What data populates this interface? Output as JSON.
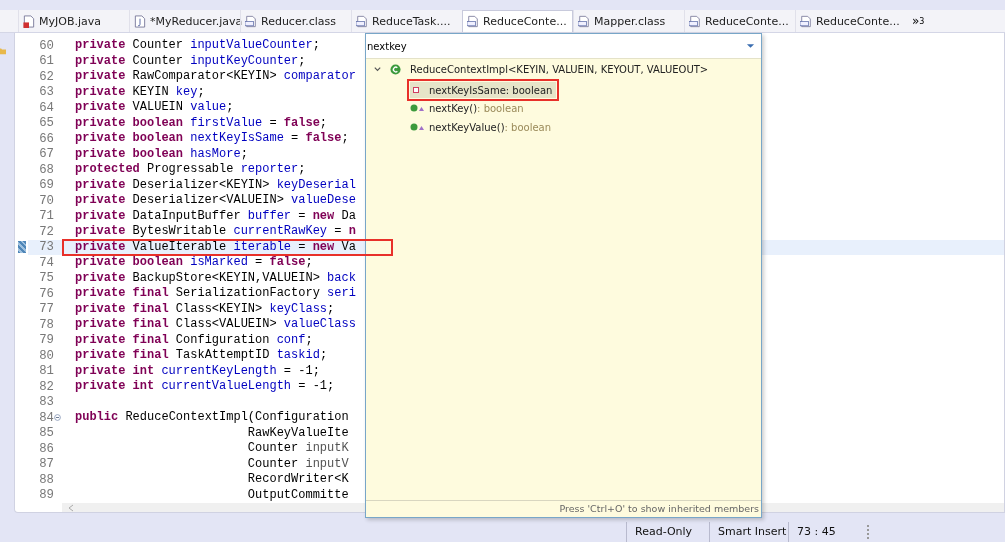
{
  "tabs": [
    {
      "label": "MyJOB.java",
      "kind": "java-error",
      "selected": false
    },
    {
      "label": "*MyReducer.java",
      "kind": "java",
      "selected": false
    },
    {
      "label": "Reducer.class",
      "kind": "class",
      "selected": false
    },
    {
      "label": "ReduceTask....",
      "kind": "class",
      "selected": false
    },
    {
      "label": "ReduceConte...",
      "kind": "class",
      "selected": true
    },
    {
      "label": "Mapper.class",
      "kind": "class",
      "selected": false
    },
    {
      "label": "ReduceConte...",
      "kind": "class",
      "selected": false
    },
    {
      "label": "ReduceConte...",
      "kind": "class",
      "selected": false
    }
  ],
  "tab_overflow": {
    "symbol": "»",
    "count": "3"
  },
  "code_lines": [
    {
      "number": "60",
      "current": false,
      "fold": false,
      "tokens": [
        {
          "kind": "keyword",
          "text": "private "
        },
        {
          "kind": "plain",
          "text": "Counter "
        },
        {
          "kind": "field",
          "text": "inputValueCounter"
        },
        {
          "kind": "plain",
          "text": ";"
        }
      ]
    },
    {
      "number": "61",
      "current": false,
      "fold": false,
      "tokens": [
        {
          "kind": "keyword",
          "text": "private "
        },
        {
          "kind": "plain",
          "text": "Counter "
        },
        {
          "kind": "field",
          "text": "inputKeyCounter"
        },
        {
          "kind": "plain",
          "text": ";"
        }
      ]
    },
    {
      "number": "62",
      "current": false,
      "fold": false,
      "tokens": [
        {
          "kind": "keyword",
          "text": "private "
        },
        {
          "kind": "plain",
          "text": "RawComparator<KEYIN> "
        },
        {
          "kind": "field",
          "text": "comparator"
        }
      ]
    },
    {
      "number": "63",
      "current": false,
      "fold": false,
      "tokens": [
        {
          "kind": "keyword",
          "text": "private "
        },
        {
          "kind": "plain",
          "text": "KEYIN "
        },
        {
          "kind": "field",
          "text": "key"
        },
        {
          "kind": "plain",
          "text": ";"
        }
      ]
    },
    {
      "number": "64",
      "current": false,
      "fold": false,
      "tokens": [
        {
          "kind": "keyword",
          "text": "private "
        },
        {
          "kind": "plain",
          "text": "VALUEIN "
        },
        {
          "kind": "field",
          "text": "value"
        },
        {
          "kind": "plain",
          "text": ";"
        }
      ]
    },
    {
      "number": "65",
      "current": false,
      "fold": false,
      "tokens": [
        {
          "kind": "keyword",
          "text": "private boolean "
        },
        {
          "kind": "field",
          "text": "firstValue"
        },
        {
          "kind": "plain",
          "text": " = "
        },
        {
          "kind": "keyword",
          "text": "false"
        },
        {
          "kind": "plain",
          "text": ";"
        }
      ]
    },
    {
      "number": "66",
      "current": false,
      "fold": false,
      "tokens": [
        {
          "kind": "keyword",
          "text": "private boolean "
        },
        {
          "kind": "field",
          "text": "nextKeyIsSame"
        },
        {
          "kind": "plain",
          "text": " = "
        },
        {
          "kind": "keyword",
          "text": "false"
        },
        {
          "kind": "plain",
          "text": ";"
        }
      ]
    },
    {
      "number": "67",
      "current": false,
      "fold": false,
      "tokens": [
        {
          "kind": "keyword",
          "text": "private boolean "
        },
        {
          "kind": "field",
          "text": "hasMore"
        },
        {
          "kind": "plain",
          "text": ";"
        }
      ]
    },
    {
      "number": "68",
      "current": false,
      "fold": false,
      "tokens": [
        {
          "kind": "keyword",
          "text": "protected "
        },
        {
          "kind": "plain",
          "text": "Progressable "
        },
        {
          "kind": "field",
          "text": "reporter"
        },
        {
          "kind": "plain",
          "text": ";"
        }
      ]
    },
    {
      "number": "69",
      "current": false,
      "fold": false,
      "tokens": [
        {
          "kind": "keyword",
          "text": "private "
        },
        {
          "kind": "plain",
          "text": "Deserializer<KEYIN> "
        },
        {
          "kind": "field",
          "text": "keyDeserial"
        }
      ]
    },
    {
      "number": "70",
      "current": false,
      "fold": false,
      "tokens": [
        {
          "kind": "keyword",
          "text": "private "
        },
        {
          "kind": "plain",
          "text": "Deserializer<VALUEIN> "
        },
        {
          "kind": "field",
          "text": "valueDese"
        }
      ]
    },
    {
      "number": "71",
      "current": false,
      "fold": false,
      "tokens": [
        {
          "kind": "keyword",
          "text": "private "
        },
        {
          "kind": "plain",
          "text": "DataInputBuffer "
        },
        {
          "kind": "field",
          "text": "buffer"
        },
        {
          "kind": "plain",
          "text": " = "
        },
        {
          "kind": "keyword",
          "text": "new "
        },
        {
          "kind": "plain",
          "text": "Da"
        }
      ]
    },
    {
      "number": "72",
      "current": false,
      "fold": false,
      "tokens": [
        {
          "kind": "keyword",
          "text": "private "
        },
        {
          "kind": "plain",
          "text": "BytesWritable "
        },
        {
          "kind": "field",
          "text": "currentRawKey"
        },
        {
          "kind": "plain",
          "text": " = "
        },
        {
          "kind": "keyword",
          "text": "n"
        }
      ]
    },
    {
      "number": "73",
      "current": true,
      "fold": false,
      "tokens": [
        {
          "kind": "keyword",
          "text": "private "
        },
        {
          "kind": "plain",
          "text": "ValueIterable "
        },
        {
          "kind": "field",
          "text": "iterable"
        },
        {
          "kind": "plain",
          "text": " = "
        },
        {
          "kind": "keyword",
          "text": "new "
        },
        {
          "kind": "plain",
          "text": "Va"
        }
      ]
    },
    {
      "number": "74",
      "current": false,
      "fold": false,
      "tokens": [
        {
          "kind": "keyword",
          "text": "private boolean "
        },
        {
          "kind": "field",
          "text": "isMarked"
        },
        {
          "kind": "plain",
          "text": " = "
        },
        {
          "kind": "keyword",
          "text": "false"
        },
        {
          "kind": "plain",
          "text": ";"
        }
      ]
    },
    {
      "number": "75",
      "current": false,
      "fold": false,
      "tokens": [
        {
          "kind": "keyword",
          "text": "private "
        },
        {
          "kind": "plain",
          "text": "BackupStore<KEYIN,VALUEIN> "
        },
        {
          "kind": "field",
          "text": "back"
        }
      ]
    },
    {
      "number": "76",
      "current": false,
      "fold": false,
      "tokens": [
        {
          "kind": "keyword",
          "text": "private final "
        },
        {
          "kind": "plain",
          "text": "SerializationFactory "
        },
        {
          "kind": "field",
          "text": "seri"
        }
      ]
    },
    {
      "number": "77",
      "current": false,
      "fold": false,
      "tokens": [
        {
          "kind": "keyword",
          "text": "private final "
        },
        {
          "kind": "plain",
          "text": "Class<KEYIN> "
        },
        {
          "kind": "field",
          "text": "keyClass"
        },
        {
          "kind": "plain",
          "text": ";"
        }
      ]
    },
    {
      "number": "78",
      "current": false,
      "fold": false,
      "tokens": [
        {
          "kind": "keyword",
          "text": "private final "
        },
        {
          "kind": "plain",
          "text": "Class<VALUEIN> "
        },
        {
          "kind": "field",
          "text": "valueClass"
        }
      ]
    },
    {
      "number": "79",
      "current": false,
      "fold": false,
      "tokens": [
        {
          "kind": "keyword",
          "text": "private final "
        },
        {
          "kind": "plain",
          "text": "Configuration "
        },
        {
          "kind": "field",
          "text": "conf"
        },
        {
          "kind": "plain",
          "text": ";"
        }
      ]
    },
    {
      "number": "80",
      "current": false,
      "fold": false,
      "tokens": [
        {
          "kind": "keyword",
          "text": "private final "
        },
        {
          "kind": "plain",
          "text": "TaskAttemptID "
        },
        {
          "kind": "field",
          "text": "taskid"
        },
        {
          "kind": "plain",
          "text": ";"
        }
      ]
    },
    {
      "number": "81",
      "current": false,
      "fold": false,
      "tokens": [
        {
          "kind": "keyword",
          "text": "private int "
        },
        {
          "kind": "field",
          "text": "currentKeyLength"
        },
        {
          "kind": "plain",
          "text": " = -1;"
        }
      ]
    },
    {
      "number": "82",
      "current": false,
      "fold": false,
      "tokens": [
        {
          "kind": "keyword",
          "text": "private int "
        },
        {
          "kind": "field",
          "text": "currentValueLength"
        },
        {
          "kind": "plain",
          "text": " = -1;"
        }
      ]
    },
    {
      "number": "83",
      "current": false,
      "fold": false
    },
    {
      "number": "84",
      "current": false,
      "fold": true,
      "tokens": [
        {
          "kind": "keyword",
          "text": "public "
        },
        {
          "kind": "plain",
          "text": "ReduceContextImpl(Configuration"
        }
      ]
    },
    {
      "number": "85",
      "current": false,
      "fold": false,
      "tokens": [
        {
          "kind": "plain",
          "text": "                        RawKeyValueIte"
        }
      ]
    },
    {
      "number": "86",
      "current": false,
      "fold": false,
      "tokens": [
        {
          "kind": "plain",
          "text": "                        Counter "
        },
        {
          "kind": "param",
          "text": "inputK"
        }
      ]
    },
    {
      "number": "87",
      "current": false,
      "fold": false,
      "tokens": [
        {
          "kind": "plain",
          "text": "                        Counter "
        },
        {
          "kind": "param",
          "text": "inputV"
        }
      ]
    },
    {
      "number": "88",
      "current": false,
      "fold": false,
      "tokens": [
        {
          "kind": "plain",
          "text": "                        RecordWriter<K"
        }
      ]
    },
    {
      "number": "89",
      "current": false,
      "fold": false,
      "tokens": [
        {
          "kind": "plain",
          "text": "                        OutputCommitte"
        }
      ]
    }
  ],
  "outline_popup": {
    "filter": "nextkey",
    "root": {
      "label": "ReduceContextImpl<KEYIN, VALUEIN, KEYOUT, VALUEOUT>",
      "expanded": true,
      "children": [
        {
          "kind": "field",
          "name": "nextKeyIsSame",
          "type": " : boolean",
          "selected": true
        },
        {
          "kind": "method",
          "name": "nextKey()",
          "type": " : boolean",
          "selected": false
        },
        {
          "kind": "method",
          "name": "nextKeyValue()",
          "type": " : boolean",
          "selected": false
        }
      ]
    },
    "hint": "Press 'Ctrl+O' to show inherited members"
  },
  "status_bar": [
    "Read-Only",
    "Smart Insert",
    "73 : 45"
  ]
}
